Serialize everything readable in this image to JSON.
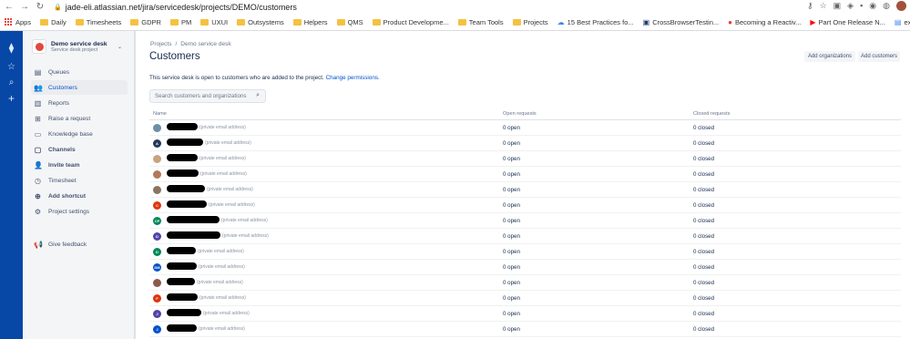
{
  "browser": {
    "url": "jade-eli.atlassian.net/jira/servicedesk/projects/DEMO/customers",
    "bookmarks": [
      {
        "label": "Apps",
        "kind": "apps"
      },
      {
        "label": "Daily",
        "kind": "folder"
      },
      {
        "label": "Timesheets",
        "kind": "folder"
      },
      {
        "label": "GDPR",
        "kind": "folder"
      },
      {
        "label": "PM",
        "kind": "folder"
      },
      {
        "label": "UXUI",
        "kind": "folder"
      },
      {
        "label": "Outsystems",
        "kind": "folder"
      },
      {
        "label": "Helpers",
        "kind": "folder"
      },
      {
        "label": "QMS",
        "kind": "folder"
      },
      {
        "label": "Product Developme...",
        "kind": "folder"
      },
      {
        "label": "Team Tools",
        "kind": "folder"
      },
      {
        "label": "Projects",
        "kind": "folder"
      },
      {
        "label": "15 Best Practices fo...",
        "kind": "cloud"
      },
      {
        "label": "CrossBrowserTestin...",
        "kind": "cbt"
      },
      {
        "label": "Becoming a Reactiv...",
        "kind": "reactive"
      },
      {
        "label": "Part One Release N...",
        "kind": "youtube"
      },
      {
        "label": "exploratory_testing...",
        "kind": "doc"
      }
    ]
  },
  "sidebar": {
    "project_name": "Demo service desk",
    "project_type": "Service desk project",
    "items": [
      {
        "label": "Queues",
        "icon": "queues-icon",
        "glyph": "▤",
        "active": false,
        "bold": false
      },
      {
        "label": "Customers",
        "icon": "customers-icon",
        "glyph": "👥",
        "active": true,
        "bold": false
      },
      {
        "label": "Reports",
        "icon": "reports-icon",
        "glyph": "▥",
        "active": false,
        "bold": false
      },
      {
        "label": "Raise a request",
        "icon": "raise-request-icon",
        "glyph": "⊞",
        "active": false,
        "bold": false
      },
      {
        "label": "Knowledge base",
        "icon": "knowledge-base-icon",
        "glyph": "▭",
        "active": false,
        "bold": false
      },
      {
        "label": "Channels",
        "icon": "channels-icon",
        "glyph": "▢",
        "active": false,
        "bold": true
      },
      {
        "label": "Invite team",
        "icon": "invite-team-icon",
        "glyph": "👤",
        "active": false,
        "bold": true
      },
      {
        "label": "Timesheet",
        "icon": "timesheet-icon",
        "glyph": "◷",
        "active": false,
        "bold": false
      },
      {
        "label": "Add shortcut",
        "icon": "add-shortcut-icon",
        "glyph": "⊕",
        "active": false,
        "bold": true
      },
      {
        "label": "Project settings",
        "icon": "settings-icon",
        "glyph": "⚙",
        "active": false,
        "bold": false
      }
    ],
    "feedback": "Give feedback"
  },
  "main": {
    "breadcrumb": [
      "Projects",
      "Demo service desk"
    ],
    "breadcrumb_sep": "/",
    "title": "Customers",
    "add_organizations": "Add organizations",
    "add_customers": "Add customers",
    "info_text": "This service desk is open to customers who are added to the project.",
    "info_link": "Change permissions.",
    "search_placeholder": "Search customers and organizations",
    "columns": {
      "name": "Name",
      "open": "Open requests",
      "closed": "Closed requests"
    }
  },
  "customers": [
    {
      "initials": "",
      "avatar": "#6b8fa3",
      "email": "(private email address)",
      "open": "0 open",
      "closed": "0 closed"
    },
    {
      "initials": "A",
      "avatar": "#253858",
      "email": "(private email address)",
      "open": "0 open",
      "closed": "0 closed"
    },
    {
      "initials": "",
      "avatar": "#c9a27e",
      "email": "(private email address)",
      "open": "0 open",
      "closed": "0 closed"
    },
    {
      "initials": "",
      "avatar": "#b07a5a",
      "email": "(private email address)",
      "open": "0 open",
      "closed": "0 closed"
    },
    {
      "initials": "",
      "avatar": "#8a7560",
      "email": "(private email address)",
      "open": "0 open",
      "closed": "0 closed"
    },
    {
      "initials": "C",
      "avatar": "#de350b",
      "email": "(private email address)",
      "open": "0 open",
      "closed": "0 closed"
    },
    {
      "initials": "CP",
      "avatar": "#00875a",
      "email": "(private email address)",
      "open": "0 open",
      "closed": "0 closed"
    },
    {
      "initials": "D",
      "avatar": "#5243aa",
      "email": "(private email address)",
      "open": "0 open",
      "closed": "0 closed"
    },
    {
      "initials": "D",
      "avatar": "#00875a",
      "email": "(private email address)",
      "open": "0 open",
      "closed": "0 closed"
    },
    {
      "initials": "DM",
      "avatar": "#0052cc",
      "email": "(private email address)",
      "open": "0 open",
      "closed": "0 closed"
    },
    {
      "initials": "",
      "avatar": "#8c5a4a",
      "email": "(private email address)",
      "open": "0 open",
      "closed": "0 closed"
    },
    {
      "initials": "F",
      "avatar": "#de350b",
      "email": "(private email address)",
      "open": "0 open",
      "closed": "0 closed"
    },
    {
      "initials": "J",
      "avatar": "#5243aa",
      "email": "(private email address)",
      "open": "0 open",
      "closed": "0 closed"
    },
    {
      "initials": "J",
      "avatar": "#0052cc",
      "email": "(private email address)",
      "open": "0 open",
      "closed": "0 closed"
    }
  ]
}
